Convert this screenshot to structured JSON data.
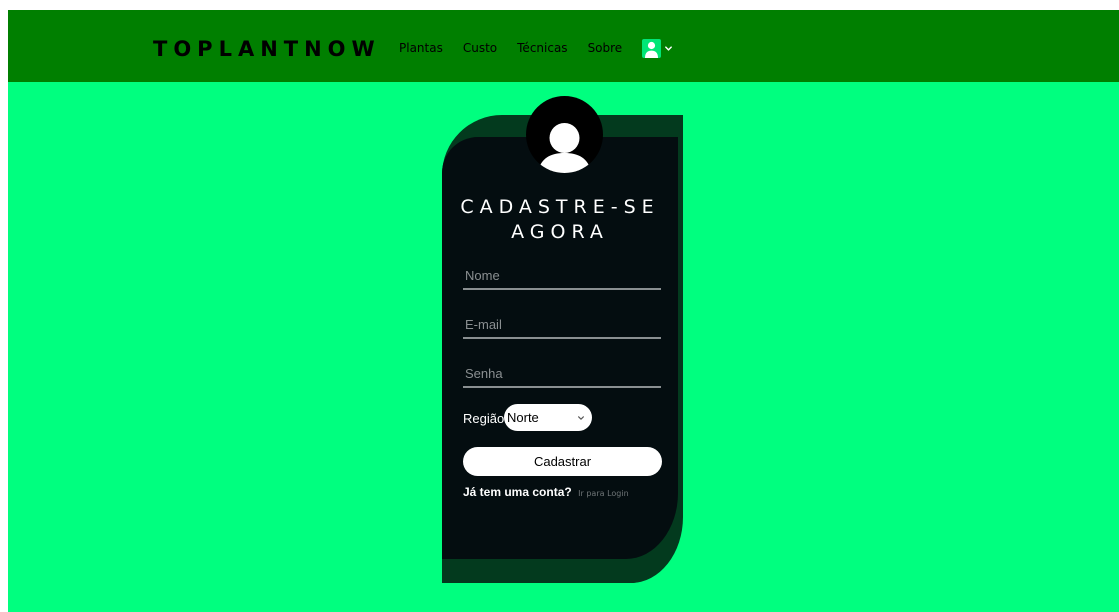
{
  "navbar": {
    "brand": "TOPLANTNOW",
    "links": [
      {
        "label": "Plantas"
      },
      {
        "label": "Custo"
      },
      {
        "label": "Técnicas"
      },
      {
        "label": "Sobre"
      }
    ],
    "user_icon": "user-icon",
    "chevron_icon": "chevron-down-icon"
  },
  "form": {
    "avatar_icon": "user-avatar-icon",
    "title": "CADASTRE-SE AGORA",
    "name_placeholder": "Nome",
    "email_placeholder": "E-mail",
    "password_placeholder": "Senha",
    "region_label": "Região",
    "region_selected": "Norte",
    "submit_label": "Cadastrar",
    "login_question": "Já tem uma conta?",
    "login_link": "Ir para Login"
  },
  "colors": {
    "page_background": "#00ff7f",
    "navbar_background": "#007f00",
    "card_background": "#040d10",
    "card_shadow": "#033a1e",
    "user_icon_background": "#00e676"
  }
}
